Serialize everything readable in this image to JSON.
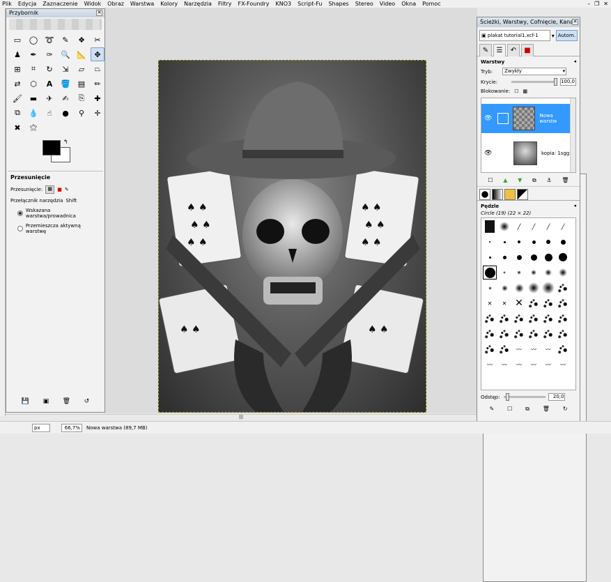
{
  "menubar": {
    "items": [
      "Plik",
      "Edycja",
      "Zaznaczenie",
      "Widok",
      "Obraz",
      "Warstwa",
      "Kolory",
      "Narzędzia",
      "Filtry",
      "FX-Foundry",
      "KNO3",
      "Script-Fu",
      "Shapes",
      "Stereo",
      "Video",
      "Okna",
      "Pomoc"
    ]
  },
  "toolbox": {
    "title": "Przybornik",
    "tool_options_title": "Przesunięcie",
    "move_label": "Przesunięcie:",
    "toggle_label": "Przełącznik narzędzia",
    "toggle_key": "Shift",
    "radio1": "Wskazana warstwa/prowadnica",
    "radio2": "Przemieszcza aktywną warstwę"
  },
  "dock": {
    "title": "Ścieżki, Warstwy, Cofnięcie, Kana...",
    "image_name": "plakat tutorial1.xcf-1",
    "auto_label": "Autom.",
    "layers_title": "Warstwy",
    "mode_label": "Tryb:",
    "mode_value": "Zwykły",
    "opacity_label": "Krycie:",
    "opacity_value": "100,0",
    "lock_label": "Blokowanie:",
    "layers": [
      {
        "name": "Nowa warstw",
        "selected": true
      },
      {
        "name": "kopia: 1sgg",
        "selected": false
      }
    ],
    "brushes_title": "Pędzle",
    "brush_name": "Circle (19) (22 × 22)",
    "spacing_label": "Odstęp:",
    "spacing_value": "20,0"
  },
  "statusbar": {
    "unit": "px",
    "zoom": "66,7%",
    "status": "Nowa warstwa (89,7 MB)"
  },
  "colors": {
    "selection": "#3399ff",
    "fg": "#000000",
    "bg": "#ffffff"
  }
}
